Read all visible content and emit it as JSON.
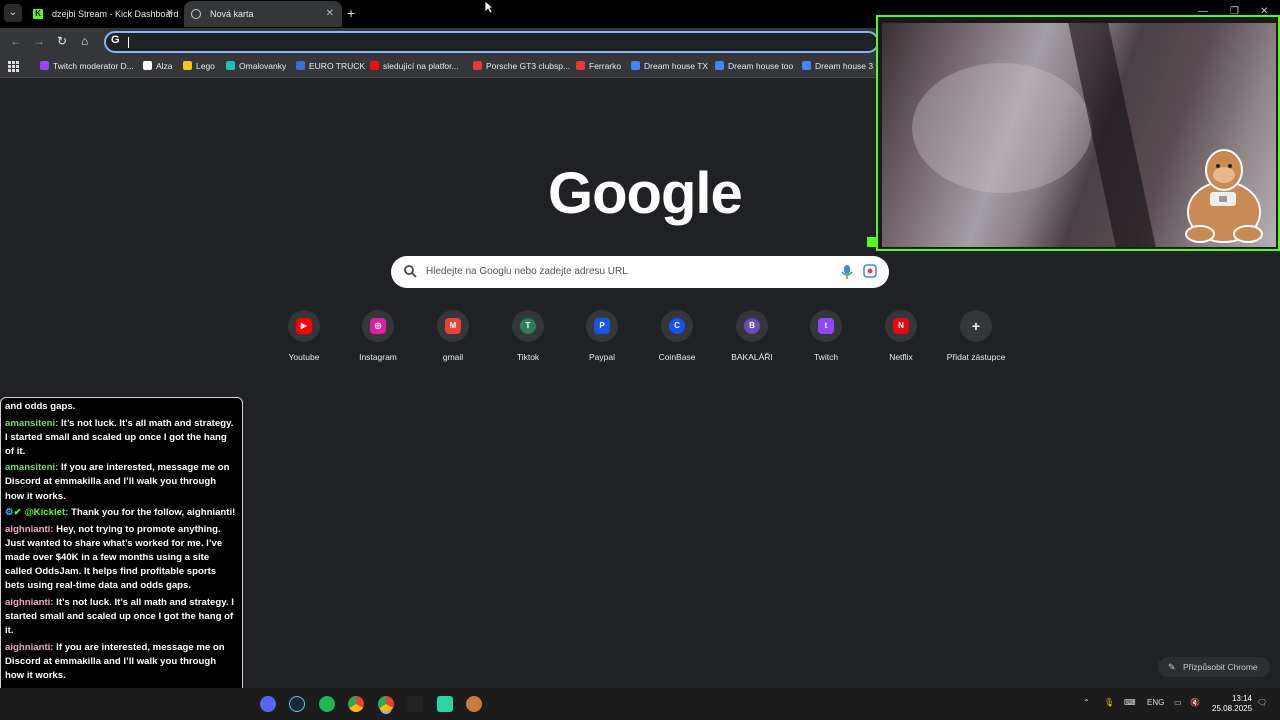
{
  "tabs": [
    {
      "title": "dzejbi Stream - Kick Dashboard",
      "favicon": "kick-icon"
    },
    {
      "title": "Nová karta",
      "favicon": "globe-icon"
    }
  ],
  "bookmarks": [
    {
      "label": "Twitch moderator D...",
      "color": "#9146ff"
    },
    {
      "label": "Alza",
      "color": "#ffffff"
    },
    {
      "label": "Lego",
      "color": "#f5c518"
    },
    {
      "label": "Omalovanky",
      "color": "#19c3b4"
    },
    {
      "label": "EURO TRUCK",
      "color": "#3b6fd6"
    },
    {
      "label": "sledující na platfor...",
      "color": "#e11"
    },
    {
      "label": "Porsche GT3 clubsp...",
      "color": "#e53935"
    },
    {
      "label": "Ferrarko",
      "color": "#e53935"
    },
    {
      "label": "Dream house TX",
      "color": "#4285f4"
    },
    {
      "label": "Dream house too",
      "color": "#4285f4"
    },
    {
      "label": "Dream house 3",
      "color": "#4285f4"
    }
  ],
  "google_logo": "Google",
  "search": {
    "placeholder": "Hledejte na Googlu nebo zadejte adresu URL"
  },
  "shortcuts": [
    {
      "label": "Youtube",
      "glyph": "▶",
      "color": "#ff0000"
    },
    {
      "label": "Instagram",
      "glyph": "◎",
      "color": "#d6249f"
    },
    {
      "label": "gmail",
      "glyph": "M",
      "color": "#ea4335"
    },
    {
      "label": "Tiktok",
      "glyph": "T",
      "color": "#2e7d5b"
    },
    {
      "label": "Paypal",
      "glyph": "P",
      "color": "#1a56db"
    },
    {
      "label": "CoinBase",
      "glyph": "C",
      "color": "#1652f0"
    },
    {
      "label": "BAKALÁŘI",
      "glyph": "B",
      "color": "#6a4fb0"
    },
    {
      "label": "Twitch",
      "glyph": "t",
      "color": "#9146ff"
    },
    {
      "label": "Netflix",
      "glyph": "N",
      "color": "#e50914"
    },
    {
      "label": "Přidat zástupce",
      "glyph": "+",
      "color": "#35363a"
    }
  ],
  "customize": {
    "label": "Přizpůsobit Chrome"
  },
  "chat": [
    {
      "user": "",
      "color": "#ffffff",
      "text": "and odds gaps."
    },
    {
      "user": "amansiteni:",
      "color": "#7bd96b",
      "text": " It’s not luck. It’s all math and strategy. I started small and scaled up once I got the hang of it."
    },
    {
      "user": "amansiteni:",
      "color": "#7bd96b",
      "text": " If you are interested, message me on Discord at emmakilla and I’ll walk you through how it works."
    },
    {
      "user": "@Kicklet:",
      "color": "#53fc18",
      "text": " Thank you for the follow, aighnianti!"
    },
    {
      "user": "aighnianti:",
      "color": "#f0a8c8",
      "text": " Hey, not trying to promote anything. Just wanted to share what’s worked for me. I’ve made over $40K in a few months using a site called OddsJam. It helps find profitable sports bets using real-time data and odds gaps."
    },
    {
      "user": "aighnianti:",
      "color": "#f0a8c8",
      "text": " It’s not luck. It’s all math and strategy. I started small and scaled up once I got the hang of it."
    },
    {
      "user": "aighnianti:",
      "color": "#f0a8c8",
      "text": " If you are interested, message me on Discord at emmakilla and I’ll walk you through how it works."
    }
  ],
  "tray": {
    "lang": "ENG",
    "time": "13:14",
    "date": "25.08.2025"
  }
}
